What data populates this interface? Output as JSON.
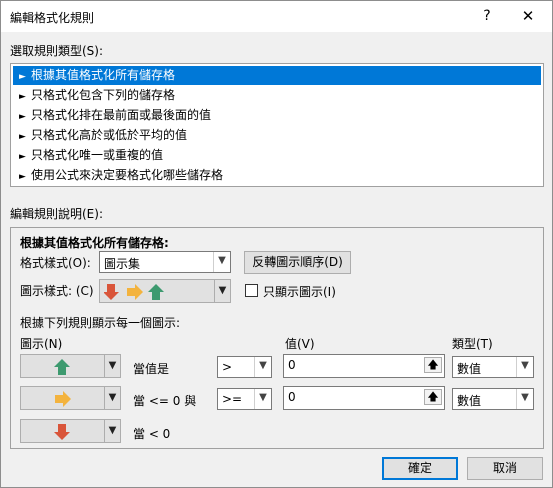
{
  "titlebar": {
    "title": "編輯格式化規則",
    "help": "?",
    "close": "✕"
  },
  "rule_type": {
    "label": "選取規則類型(S):",
    "items": [
      {
        "label": "根據其值格式化所有儲存格",
        "selected": true
      },
      {
        "label": "只格式化包含下列的儲存格",
        "selected": false
      },
      {
        "label": "只格式化排在最前面或最後面的值",
        "selected": false
      },
      {
        "label": "只格式化高於或低於平均的值",
        "selected": false
      },
      {
        "label": "只格式化唯一或重複的值",
        "selected": false
      },
      {
        "label": "使用公式來決定要格式化哪些儲存格",
        "selected": false
      }
    ],
    "arrow": "►"
  },
  "description": {
    "label": "編輯規則說明(E):",
    "heading": "根據其值格式化所有儲存格:",
    "format_style_label": "格式樣式(O):",
    "format_style_value": "圖示集",
    "reverse_button": "反轉圖示順序(D)",
    "icon_style_label": "圖示樣式: (C)",
    "show_icon_only_label": "只顯示圖示(I)",
    "show_icon_only_checked": false,
    "rules_heading": "根據下列規則顯示每一個圖示:",
    "col_icon": "圖示(N)",
    "col_value": "值(V)",
    "col_type": "類型(T)",
    "rows": [
      {
        "icon": "up-arrow-green",
        "condition": "當值是",
        "operator": ">",
        "value": "0",
        "type": "數值"
      },
      {
        "icon": "right-arrow-yellow",
        "condition": "當 <= 0 與",
        "operator": ">=",
        "value": "0",
        "type": "數值"
      },
      {
        "icon": "down-arrow-red",
        "condition": "當 < 0",
        "operator": null,
        "value": null,
        "type": null
      }
    ]
  },
  "footer": {
    "ok": "確定",
    "cancel": "取消"
  },
  "colors": {
    "selection": "#0078d7",
    "green": "#3d9a6f",
    "yellow": "#f3b33e",
    "red": "#d9553a"
  }
}
